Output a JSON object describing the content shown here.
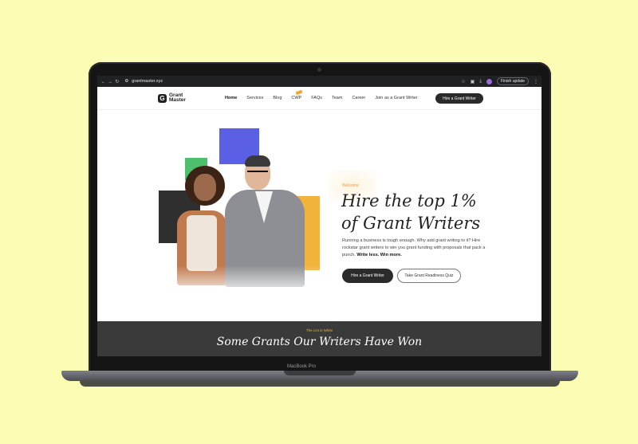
{
  "browser": {
    "nav_icons": [
      "arrow-left-icon",
      "arrow-right-icon",
      "reload-icon"
    ],
    "url": "grantmaster.xyz",
    "finish_update": "Finish update"
  },
  "device": {
    "label": "MacBook Pro"
  },
  "site": {
    "logo": "Grant Master",
    "menu": [
      "Home",
      "Services",
      "Blog",
      "CWP",
      "FAQs",
      "Team",
      "Career",
      "Join as a Grant Writer"
    ],
    "header_cta": "Hire a Grant Writer"
  },
  "hero": {
    "kicker": "Welcome",
    "headline_line1": "Hire the top 1%",
    "headline_line2": "of Grant Writers",
    "blurb": "Running a business is tough enough. Why add grant writing to it? Hire rockstar grant writers to win you grant funding with proposals that pack a punch.",
    "blurb_bold": "Write less. Win more.",
    "primary_cta": "Hire a Grant Writer",
    "secondary_cta": "Take Grant Readiness Quiz"
  },
  "band": {
    "kicker": "The List is White",
    "title": "Some Grants Our Writers Have Won"
  },
  "colors": {
    "background": "#fbfdb4",
    "accent_orange": "#f2b33a",
    "accent_blue": "#5b5fe6",
    "accent_green": "#4cc06a",
    "dark": "#2b2b2b"
  }
}
